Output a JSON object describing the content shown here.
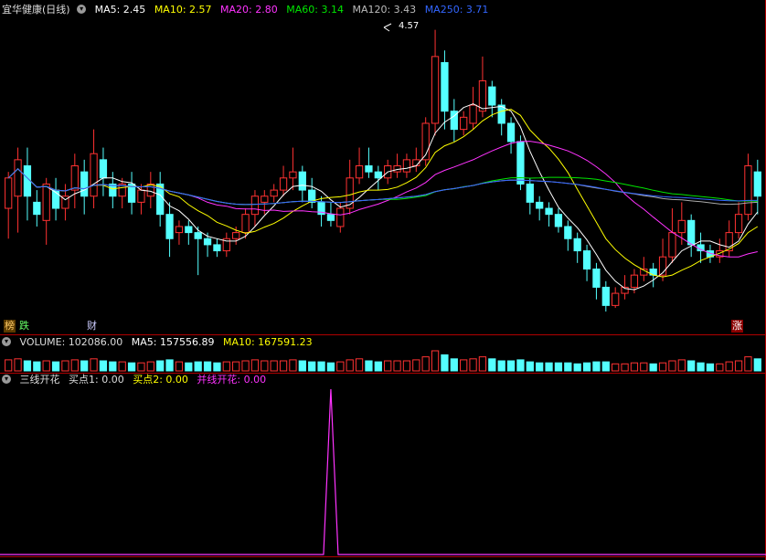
{
  "main_legend": {
    "title": "宜华健康(日线)",
    "ma5": "MA5: 2.45",
    "ma10": "MA10: 2.57",
    "ma20": "MA20: 2.80",
    "ma60": "MA60: 3.14",
    "ma120": "MA120: 3.43",
    "ma250": "MA250: 3.71"
  },
  "volume_legend": {
    "name": "VOLUME: 102086.00",
    "ma5": "MA5: 157556.89",
    "ma10": "MA10: 167591.23"
  },
  "indicator_legend": {
    "name": "三线开花",
    "buy1": "买点1: 0.00",
    "buy2": "买点2: 0.00",
    "bloom": "并线开花: 0.00"
  },
  "badges": {
    "b1": "榜",
    "b2": "跌",
    "b3": "财",
    "b4": "涨"
  },
  "annotation": "4.57",
  "colors": {
    "up": "#ff3232",
    "down": "#54ffff",
    "ma5": "#ffffff",
    "ma10": "#ffff00",
    "ma20": "#ff33ff",
    "ma60": "#00e600",
    "ma120": "#aaaaaa",
    "ma250": "#3366ff",
    "bloom": "#ff33ff",
    "grid": "#b00000"
  },
  "chart_data": {
    "type": "candlestick",
    "price_range": [
      2.22,
      4.65
    ],
    "candles": [
      [
        3.1,
        3.35,
        2.85,
        3.4
      ],
      [
        3.2,
        3.5,
        2.9,
        3.6
      ],
      [
        3.45,
        3.2,
        3.0,
        3.6
      ],
      [
        3.15,
        3.05,
        2.95,
        3.25
      ],
      [
        3.0,
        3.3,
        2.8,
        3.35
      ],
      [
        3.25,
        3.1,
        3.0,
        3.35
      ],
      [
        3.1,
        3.2,
        3.0,
        3.3
      ],
      [
        3.25,
        3.45,
        3.1,
        3.55
      ],
      [
        3.4,
        3.2,
        3.05,
        3.5
      ],
      [
        3.2,
        3.55,
        3.1,
        3.75
      ],
      [
        3.5,
        3.35,
        3.2,
        3.6
      ],
      [
        3.3,
        3.2,
        3.1,
        3.4
      ],
      [
        3.2,
        3.3,
        3.1,
        3.35
      ],
      [
        3.3,
        3.15,
        3.05,
        3.4
      ],
      [
        3.15,
        3.25,
        3.05,
        3.3
      ],
      [
        3.2,
        3.3,
        3.1,
        3.4
      ],
      [
        3.3,
        3.05,
        2.95,
        3.4
      ],
      [
        3.05,
        2.85,
        2.7,
        3.15
      ],
      [
        2.9,
        2.95,
        2.8,
        3.0
      ],
      [
        2.95,
        2.9,
        2.8,
        3.0
      ],
      [
        2.9,
        2.85,
        2.55,
        2.95
      ],
      [
        2.85,
        2.8,
        2.7,
        2.9
      ],
      [
        2.8,
        2.75,
        2.7,
        2.85
      ],
      [
        2.75,
        2.85,
        2.7,
        2.9
      ],
      [
        2.85,
        2.9,
        2.8,
        2.95
      ],
      [
        2.9,
        3.05,
        2.85,
        3.1
      ],
      [
        3.05,
        3.2,
        2.95,
        3.25
      ],
      [
        3.15,
        3.2,
        3.05,
        3.25
      ],
      [
        3.2,
        3.25,
        3.15,
        3.3
      ],
      [
        3.25,
        3.35,
        3.2,
        3.45
      ],
      [
        3.35,
        3.4,
        3.25,
        3.6
      ],
      [
        3.4,
        3.25,
        3.15,
        3.45
      ],
      [
        3.25,
        3.15,
        3.1,
        3.35
      ],
      [
        3.15,
        3.05,
        2.95,
        3.2
      ],
      [
        3.05,
        3.0,
        2.95,
        3.15
      ],
      [
        2.95,
        3.1,
        2.9,
        3.15
      ],
      [
        3.1,
        3.35,
        3.05,
        3.5
      ],
      [
        3.35,
        3.45,
        3.3,
        3.6
      ],
      [
        3.45,
        3.4,
        3.35,
        3.6
      ],
      [
        3.4,
        3.35,
        3.25,
        3.45
      ],
      [
        3.35,
        3.45,
        3.3,
        3.5
      ],
      [
        3.4,
        3.45,
        3.35,
        3.55
      ],
      [
        3.4,
        3.5,
        3.35,
        3.55
      ],
      [
        3.45,
        3.5,
        3.4,
        3.6
      ],
      [
        3.5,
        3.8,
        3.45,
        3.85
      ],
      [
        3.8,
        4.35,
        3.7,
        4.57
      ],
      [
        4.3,
        3.9,
        3.75,
        4.4
      ],
      [
        3.9,
        3.75,
        3.65,
        4.0
      ],
      [
        3.75,
        3.85,
        3.7,
        3.9
      ],
      [
        3.8,
        3.95,
        3.75,
        4.1
      ],
      [
        3.9,
        4.15,
        3.85,
        4.35
      ],
      [
        4.1,
        3.95,
        3.85,
        4.15
      ],
      [
        3.95,
        3.8,
        3.7,
        4.0
      ],
      [
        3.8,
        3.65,
        3.55,
        3.85
      ],
      [
        3.65,
        3.3,
        3.25,
        3.7
      ],
      [
        3.3,
        3.15,
        3.05,
        3.35
      ],
      [
        3.15,
        3.1,
        3.0,
        3.2
      ],
      [
        3.1,
        3.05,
        2.95,
        3.15
      ],
      [
        3.05,
        2.95,
        2.9,
        3.1
      ],
      [
        2.95,
        2.85,
        2.75,
        3.0
      ],
      [
        2.85,
        2.75,
        2.65,
        2.9
      ],
      [
        2.75,
        2.6,
        2.5,
        2.8
      ],
      [
        2.6,
        2.45,
        2.35,
        2.65
      ],
      [
        2.45,
        2.3,
        2.25,
        2.5
      ],
      [
        2.3,
        2.4,
        2.28,
        2.45
      ],
      [
        2.4,
        2.45,
        2.35,
        2.55
      ],
      [
        2.45,
        2.55,
        2.4,
        2.6
      ],
      [
        2.55,
        2.6,
        2.5,
        2.7
      ],
      [
        2.6,
        2.55,
        2.45,
        2.65
      ],
      [
        2.55,
        2.7,
        2.5,
        2.85
      ],
      [
        2.7,
        2.9,
        2.65,
        3.1
      ],
      [
        2.9,
        3.0,
        2.8,
        3.15
      ],
      [
        3.0,
        2.8,
        2.7,
        3.05
      ],
      [
        2.8,
        2.75,
        2.65,
        2.9
      ],
      [
        2.75,
        2.7,
        2.65,
        2.8
      ],
      [
        2.7,
        2.75,
        2.65,
        2.85
      ],
      [
        2.75,
        2.9,
        2.7,
        3.0
      ],
      [
        2.9,
        3.05,
        2.85,
        3.15
      ],
      [
        3.05,
        3.45,
        3.0,
        3.55
      ],
      [
        3.4,
        3.2,
        3.05,
        3.5
      ]
    ],
    "volume": [
      0.55,
      0.6,
      0.5,
      0.45,
      0.5,
      0.45,
      0.5,
      0.55,
      0.5,
      0.6,
      0.5,
      0.45,
      0.45,
      0.4,
      0.4,
      0.45,
      0.5,
      0.55,
      0.45,
      0.4,
      0.45,
      0.45,
      0.4,
      0.45,
      0.45,
      0.5,
      0.55,
      0.5,
      0.5,
      0.5,
      0.55,
      0.5,
      0.45,
      0.45,
      0.4,
      0.45,
      0.55,
      0.6,
      0.5,
      0.45,
      0.5,
      0.5,
      0.5,
      0.55,
      0.7,
      1.0,
      0.8,
      0.6,
      0.55,
      0.6,
      0.7,
      0.6,
      0.5,
      0.5,
      0.55,
      0.45,
      0.4,
      0.4,
      0.4,
      0.4,
      0.35,
      0.4,
      0.45,
      0.45,
      0.35,
      0.35,
      0.4,
      0.4,
      0.35,
      0.4,
      0.5,
      0.55,
      0.5,
      0.4,
      0.35,
      0.35,
      0.45,
      0.5,
      0.7,
      0.6
    ],
    "indicator_spike": {
      "index": 34,
      "value": 1
    }
  }
}
